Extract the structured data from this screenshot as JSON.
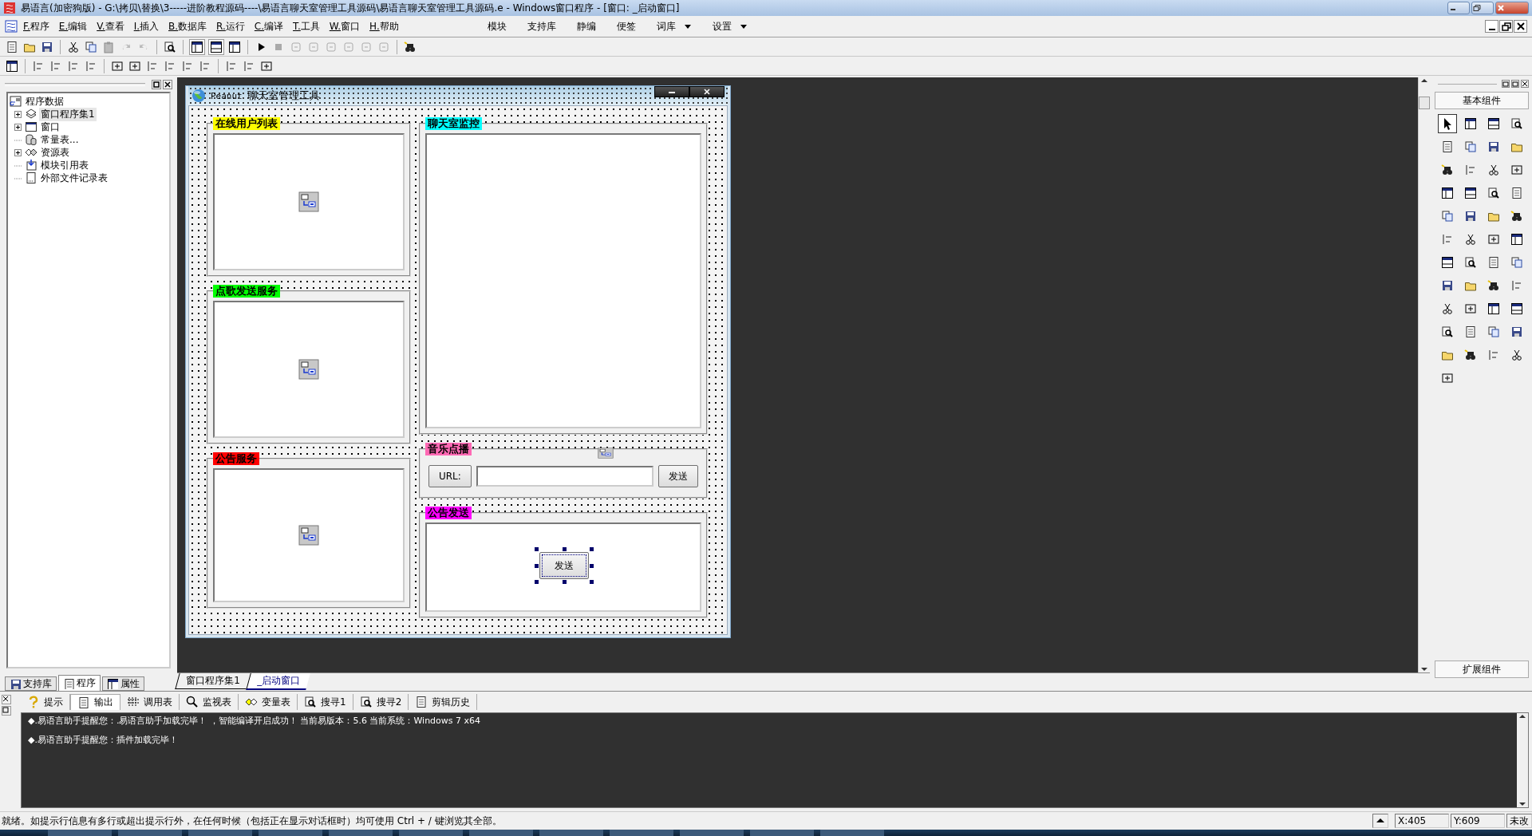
{
  "window": {
    "title": "易语言(加密狗版) - G:\\拷贝\\替换\\3-----进阶教程源码----\\易语言聊天室管理工具源码\\易语言聊天室管理工具源码.e - Windows窗口程序 - [窗口: _启动窗口]"
  },
  "menu": [
    {
      "label": "F.程序"
    },
    {
      "label": "E.编辑"
    },
    {
      "label": "V.查看"
    },
    {
      "label": "I.插入"
    },
    {
      "label": "B.数据库"
    },
    {
      "label": "R.运行"
    },
    {
      "label": "C.编译"
    },
    {
      "label": "T.工具"
    },
    {
      "label": "W.窗口"
    },
    {
      "label": "H.帮助"
    }
  ],
  "quick_menu": [
    {
      "label": "模块",
      "dropdown": false
    },
    {
      "label": "支持库",
      "dropdown": false
    },
    {
      "label": "静编",
      "dropdown": false
    },
    {
      "label": "便签",
      "dropdown": false
    },
    {
      "label": "词库",
      "dropdown": true
    },
    {
      "label": "设置",
      "dropdown": true
    }
  ],
  "left_panel": {
    "tree": {
      "label": "程序数据",
      "kind": "program",
      "children": [
        {
          "label": "窗口程序集1",
          "kind": "module_set",
          "collapsed": true,
          "selected": true
        },
        {
          "label": "窗口",
          "kind": "window",
          "collapsed": true,
          "selected": false
        },
        {
          "label": "常量表...",
          "kind": "constants",
          "collapsed": false,
          "selected": false
        },
        {
          "label": "资源表",
          "kind": "resources",
          "collapsed": true,
          "selected": false
        },
        {
          "label": "模块引用表",
          "kind": "module_refs",
          "collapsed": false,
          "selected": false
        },
        {
          "label": "外部文件记录表",
          "kind": "file_records",
          "collapsed": false,
          "selected": false
        }
      ]
    },
    "tabs": [
      {
        "label": "支持库",
        "selected": false
      },
      {
        "label": "程序",
        "selected": true
      },
      {
        "label": "属性",
        "selected": false
      }
    ]
  },
  "form": {
    "title_prefix": "Peanut",
    "title": "聊天室管理工具",
    "left_groups": [
      {
        "label": "在线用户列表",
        "color": "#ffff00",
        "kind": "service"
      },
      {
        "label": "点歌发送服务",
        "color": "#00ff00",
        "kind": "service"
      },
      {
        "label": "公告服务",
        "color": "#ff0000",
        "kind": "service"
      }
    ],
    "right_groups": [
      {
        "label": "聊天室监控",
        "color": "#00ffff",
        "kind": "monitor"
      },
      {
        "label": "音乐点播",
        "color": "#ff69b4",
        "kind": "url_bar",
        "url_label": "URL:",
        "button": {
          "label": "发送",
          "selected": false
        }
      },
      {
        "label": "公告发送",
        "color": "#ff00ff",
        "kind": "message_box",
        "button": {
          "label": "发送",
          "selected": true
        }
      }
    ]
  },
  "editor_tabs": [
    {
      "label": "窗口程序集1",
      "selected": false
    },
    {
      "label": "_启动窗口",
      "selected": true
    }
  ],
  "toolbox": {
    "title": "基本组件",
    "footer": "扩展组件"
  },
  "output_tabs": [
    {
      "label": "提示",
      "selected": false
    },
    {
      "label": "输出",
      "selected": true
    },
    {
      "label": "调用表",
      "selected": false
    },
    {
      "label": "监视表",
      "selected": false
    },
    {
      "label": "变量表",
      "selected": false
    },
    {
      "label": "搜寻1",
      "selected": false
    },
    {
      "label": "搜寻2",
      "selected": false
    },
    {
      "label": "剪辑历史",
      "selected": false
    }
  ],
  "output_lines": [
    "◆.易语言助手提醒您：.易语言助手加载完毕！ ，智能编译开启成功！ 当前易版本：5.6 当前系统：Windows 7 x64",
    "◆.易语言助手提醒您：插件加载完毕！"
  ],
  "status_bar": {
    "message": "就绪。如提示行信息有多行或超出提示行外，在任何时候（包括正在显示对话框时）均可使用 Ctrl + / 键浏览其全部。",
    "x": "X:405",
    "y": "Y:609",
    "state": "未改"
  }
}
